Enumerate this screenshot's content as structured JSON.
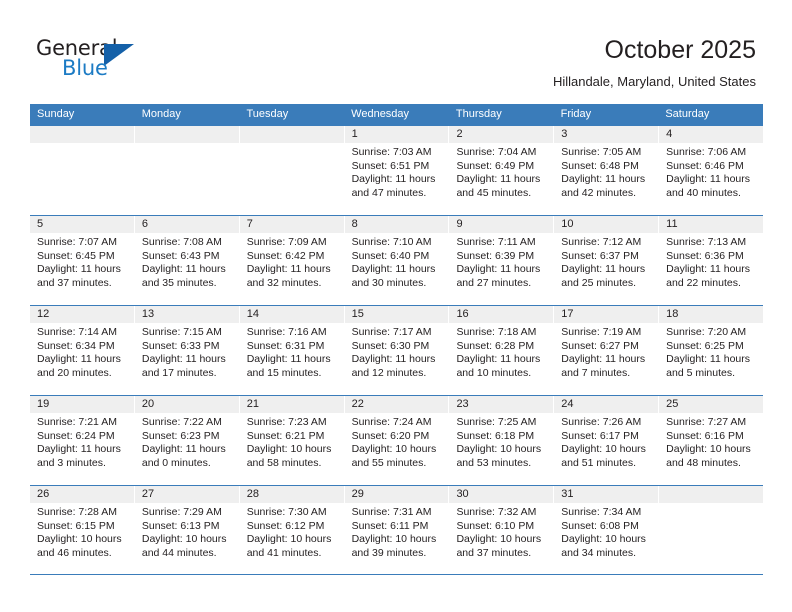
{
  "logo": {
    "word_top": "General",
    "word_bottom": "Blue",
    "triangle_color": "#1460a8",
    "blue_color": "#1c7bc4"
  },
  "header": {
    "title": "October 2025",
    "subtitle": "Hillandale, Maryland, United States"
  },
  "theme": {
    "header_blue": "#3a7cba",
    "day_number_bg": "#efefef",
    "text": "#231f20"
  },
  "weekdays": [
    "Sunday",
    "Monday",
    "Tuesday",
    "Wednesday",
    "Thursday",
    "Friday",
    "Saturday"
  ],
  "weeks": [
    [
      {
        "day": "",
        "empty": true
      },
      {
        "day": "",
        "empty": true
      },
      {
        "day": "",
        "empty": true
      },
      {
        "day": "1",
        "sunrise": "Sunrise: 7:03 AM",
        "sunset": "Sunset: 6:51 PM",
        "daylight_1": "Daylight: 11 hours",
        "daylight_2": "and 47 minutes."
      },
      {
        "day": "2",
        "sunrise": "Sunrise: 7:04 AM",
        "sunset": "Sunset: 6:49 PM",
        "daylight_1": "Daylight: 11 hours",
        "daylight_2": "and 45 minutes."
      },
      {
        "day": "3",
        "sunrise": "Sunrise: 7:05 AM",
        "sunset": "Sunset: 6:48 PM",
        "daylight_1": "Daylight: 11 hours",
        "daylight_2": "and 42 minutes."
      },
      {
        "day": "4",
        "sunrise": "Sunrise: 7:06 AM",
        "sunset": "Sunset: 6:46 PM",
        "daylight_1": "Daylight: 11 hours",
        "daylight_2": "and 40 minutes."
      }
    ],
    [
      {
        "day": "5",
        "sunrise": "Sunrise: 7:07 AM",
        "sunset": "Sunset: 6:45 PM",
        "daylight_1": "Daylight: 11 hours",
        "daylight_2": "and 37 minutes."
      },
      {
        "day": "6",
        "sunrise": "Sunrise: 7:08 AM",
        "sunset": "Sunset: 6:43 PM",
        "daylight_1": "Daylight: 11 hours",
        "daylight_2": "and 35 minutes."
      },
      {
        "day": "7",
        "sunrise": "Sunrise: 7:09 AM",
        "sunset": "Sunset: 6:42 PM",
        "daylight_1": "Daylight: 11 hours",
        "daylight_2": "and 32 minutes."
      },
      {
        "day": "8",
        "sunrise": "Sunrise: 7:10 AM",
        "sunset": "Sunset: 6:40 PM",
        "daylight_1": "Daylight: 11 hours",
        "daylight_2": "and 30 minutes."
      },
      {
        "day": "9",
        "sunrise": "Sunrise: 7:11 AM",
        "sunset": "Sunset: 6:39 PM",
        "daylight_1": "Daylight: 11 hours",
        "daylight_2": "and 27 minutes."
      },
      {
        "day": "10",
        "sunrise": "Sunrise: 7:12 AM",
        "sunset": "Sunset: 6:37 PM",
        "daylight_1": "Daylight: 11 hours",
        "daylight_2": "and 25 minutes."
      },
      {
        "day": "11",
        "sunrise": "Sunrise: 7:13 AM",
        "sunset": "Sunset: 6:36 PM",
        "daylight_1": "Daylight: 11 hours",
        "daylight_2": "and 22 minutes."
      }
    ],
    [
      {
        "day": "12",
        "sunrise": "Sunrise: 7:14 AM",
        "sunset": "Sunset: 6:34 PM",
        "daylight_1": "Daylight: 11 hours",
        "daylight_2": "and 20 minutes."
      },
      {
        "day": "13",
        "sunrise": "Sunrise: 7:15 AM",
        "sunset": "Sunset: 6:33 PM",
        "daylight_1": "Daylight: 11 hours",
        "daylight_2": "and 17 minutes."
      },
      {
        "day": "14",
        "sunrise": "Sunrise: 7:16 AM",
        "sunset": "Sunset: 6:31 PM",
        "daylight_1": "Daylight: 11 hours",
        "daylight_2": "and 15 minutes."
      },
      {
        "day": "15",
        "sunrise": "Sunrise: 7:17 AM",
        "sunset": "Sunset: 6:30 PM",
        "daylight_1": "Daylight: 11 hours",
        "daylight_2": "and 12 minutes."
      },
      {
        "day": "16",
        "sunrise": "Sunrise: 7:18 AM",
        "sunset": "Sunset: 6:28 PM",
        "daylight_1": "Daylight: 11 hours",
        "daylight_2": "and 10 minutes."
      },
      {
        "day": "17",
        "sunrise": "Sunrise: 7:19 AM",
        "sunset": "Sunset: 6:27 PM",
        "daylight_1": "Daylight: 11 hours",
        "daylight_2": "and 7 minutes."
      },
      {
        "day": "18",
        "sunrise": "Sunrise: 7:20 AM",
        "sunset": "Sunset: 6:25 PM",
        "daylight_1": "Daylight: 11 hours",
        "daylight_2": "and 5 minutes."
      }
    ],
    [
      {
        "day": "19",
        "sunrise": "Sunrise: 7:21 AM",
        "sunset": "Sunset: 6:24 PM",
        "daylight_1": "Daylight: 11 hours",
        "daylight_2": "and 3 minutes."
      },
      {
        "day": "20",
        "sunrise": "Sunrise: 7:22 AM",
        "sunset": "Sunset: 6:23 PM",
        "daylight_1": "Daylight: 11 hours",
        "daylight_2": "and 0 minutes."
      },
      {
        "day": "21",
        "sunrise": "Sunrise: 7:23 AM",
        "sunset": "Sunset: 6:21 PM",
        "daylight_1": "Daylight: 10 hours",
        "daylight_2": "and 58 minutes."
      },
      {
        "day": "22",
        "sunrise": "Sunrise: 7:24 AM",
        "sunset": "Sunset: 6:20 PM",
        "daylight_1": "Daylight: 10 hours",
        "daylight_2": "and 55 minutes."
      },
      {
        "day": "23",
        "sunrise": "Sunrise: 7:25 AM",
        "sunset": "Sunset: 6:18 PM",
        "daylight_1": "Daylight: 10 hours",
        "daylight_2": "and 53 minutes."
      },
      {
        "day": "24",
        "sunrise": "Sunrise: 7:26 AM",
        "sunset": "Sunset: 6:17 PM",
        "daylight_1": "Daylight: 10 hours",
        "daylight_2": "and 51 minutes."
      },
      {
        "day": "25",
        "sunrise": "Sunrise: 7:27 AM",
        "sunset": "Sunset: 6:16 PM",
        "daylight_1": "Daylight: 10 hours",
        "daylight_2": "and 48 minutes."
      }
    ],
    [
      {
        "day": "26",
        "sunrise": "Sunrise: 7:28 AM",
        "sunset": "Sunset: 6:15 PM",
        "daylight_1": "Daylight: 10 hours",
        "daylight_2": "and 46 minutes."
      },
      {
        "day": "27",
        "sunrise": "Sunrise: 7:29 AM",
        "sunset": "Sunset: 6:13 PM",
        "daylight_1": "Daylight: 10 hours",
        "daylight_2": "and 44 minutes."
      },
      {
        "day": "28",
        "sunrise": "Sunrise: 7:30 AM",
        "sunset": "Sunset: 6:12 PM",
        "daylight_1": "Daylight: 10 hours",
        "daylight_2": "and 41 minutes."
      },
      {
        "day": "29",
        "sunrise": "Sunrise: 7:31 AM",
        "sunset": "Sunset: 6:11 PM",
        "daylight_1": "Daylight: 10 hours",
        "daylight_2": "and 39 minutes."
      },
      {
        "day": "30",
        "sunrise": "Sunrise: 7:32 AM",
        "sunset": "Sunset: 6:10 PM",
        "daylight_1": "Daylight: 10 hours",
        "daylight_2": "and 37 minutes."
      },
      {
        "day": "31",
        "sunrise": "Sunrise: 7:34 AM",
        "sunset": "Sunset: 6:08 PM",
        "daylight_1": "Daylight: 10 hours",
        "daylight_2": "and 34 minutes."
      },
      {
        "day": "",
        "empty": true
      }
    ]
  ]
}
